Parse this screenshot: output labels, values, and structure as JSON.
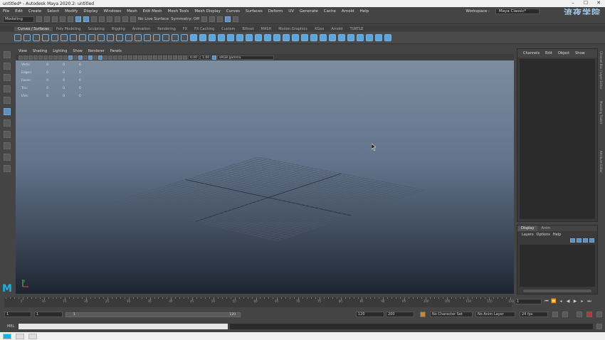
{
  "window": {
    "title": "untitled* - Autodesk Maya 2020.2: untitled",
    "controls": [
      "–",
      "☐",
      "✕"
    ]
  },
  "menubar": {
    "items": [
      "File",
      "Edit",
      "Create",
      "Select",
      "Modify",
      "Display",
      "Windows",
      "Mesh",
      "Edit Mesh",
      "Mesh Tools",
      "Mesh Display",
      "Curves",
      "Surfaces",
      "Deform",
      "UV",
      "Generate",
      "Cache",
      "Arnold",
      "Help"
    ],
    "workspace_label": "Workspace :",
    "workspace_value": "Maya Classic*",
    "watermark": "流夜学院"
  },
  "statusline": {
    "mode": "Modeling",
    "symmetry": "Symmetry: Off",
    "live_surface": "No Live Surface"
  },
  "shelf_tabs": [
    "Curves / Surfaces",
    "Poly Modeling",
    "Sculpting",
    "Rigging",
    "Animation",
    "Rendering",
    "FX",
    "FX Caching",
    "Custom",
    "Bifrost",
    "MASH",
    "Motion Graphics",
    "XGen",
    "Arnold",
    "TURTLE"
  ],
  "shelf_active": "Curves / Surfaces",
  "viewport": {
    "menu": [
      "View",
      "Shading",
      "Lighting",
      "Show",
      "Renderer",
      "Panels"
    ],
    "near": "0.00",
    "exposure": "1.00",
    "colorspace": "sRGB gamma",
    "hud": [
      {
        "label": "Verts:",
        "a": "0",
        "b": "0",
        "c": "0"
      },
      {
        "label": "Edges:",
        "a": "0",
        "b": "0",
        "c": "0"
      },
      {
        "label": "Faces:",
        "a": "0",
        "b": "0",
        "c": "0"
      },
      {
        "label": "Tris:",
        "a": "0",
        "b": "0",
        "c": "0"
      },
      {
        "label": "UVs:",
        "a": "0",
        "b": "0",
        "c": "0"
      }
    ],
    "axis_label": "y"
  },
  "channel_box": {
    "menu": [
      "Channels",
      "Edit",
      "Object",
      "Show"
    ],
    "side_tabs": [
      "Channel Box / Layer Editor",
      "Modeling Toolkit",
      "Attribute Editor"
    ]
  },
  "layer_editor": {
    "tabs": [
      "Display",
      "Anim"
    ],
    "menu": [
      "Layers",
      "Options",
      "Help"
    ]
  },
  "timeline": {
    "ticks": [
      "5",
      "10",
      "15",
      "20",
      "25",
      "30",
      "35",
      "40",
      "45",
      "50",
      "55",
      "60",
      "65",
      "70",
      "75",
      "80",
      "85",
      "90",
      "95",
      "100",
      "105",
      "110",
      "115",
      "120"
    ],
    "current_frame": "1"
  },
  "range": {
    "start": "1",
    "start_inner": "1",
    "slider_start": "1",
    "slider_end": "120",
    "end_inner": "120",
    "end": "200",
    "character_set": "No Character Set",
    "anim_layer": "No Anim Layer",
    "fps": "24 fps"
  },
  "command_line": {
    "label": "MEL"
  }
}
